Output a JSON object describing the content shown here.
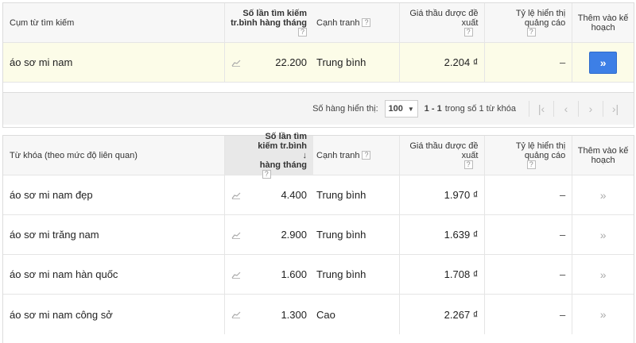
{
  "top_table": {
    "headers": {
      "keyword": "Cụm từ tìm kiếm",
      "volume_line1": "Số lần tìm kiếm",
      "volume_line2": "tr.bình hàng tháng",
      "competition": "Cạnh tranh",
      "bid_line1": "Giá thầu được đề",
      "bid_line2": "xuất",
      "impression_line1": "Tỷ lệ hiển thị",
      "impression_line2": "quảng cáo",
      "add_line1": "Thêm vào kế",
      "add_line2": "hoạch",
      "help": "?"
    },
    "rows": [
      {
        "keyword": "áo sơ mi nam",
        "volume": "22.200",
        "competition": "Trung bình",
        "bid": "2.204 ₫",
        "impression": "–",
        "add": "»"
      }
    ]
  },
  "pager": {
    "rows_label": "Số hàng hiển thị:",
    "rows_value": "100",
    "range_text": "1 - 1",
    "range_suffix": "trong số 1 từ khóa",
    "first": "|‹",
    "prev": "‹",
    "next": "›",
    "last": "›|"
  },
  "bottom_table": {
    "headers": {
      "keyword": "Từ khóa (theo mức độ liên quan)",
      "volume_line1": "Số lần tìm",
      "volume_line2": "kiếm tr.bình",
      "volume_line3": "hàng tháng",
      "sort_arrow": "↓",
      "competition": "Cạnh tranh",
      "bid_line1": "Giá thầu được đề",
      "bid_line2": "xuất",
      "impression_line1": "Tỷ lệ hiển thị",
      "impression_line2": "quảng cáo",
      "add_line1": "Thêm vào kế",
      "add_line2": "hoạch",
      "help": "?"
    },
    "rows": [
      {
        "keyword": "áo sơ mi nam đẹp",
        "volume": "4.400",
        "competition": "Trung bình",
        "bid": "1.970 ₫",
        "impression": "–",
        "add": "»"
      },
      {
        "keyword": "áo sơ mi trăng nam",
        "volume": "2.900",
        "competition": "Trung bình",
        "bid": "1.639 ₫",
        "impression": "–",
        "add": "»"
      },
      {
        "keyword": "áo sơ mi nam hàn quốc",
        "volume": "1.600",
        "competition": "Trung bình",
        "bid": "1.708 ₫",
        "impression": "–",
        "add": "»"
      },
      {
        "keyword": "áo sơ mi nam công sở",
        "volume": "1.300",
        "competition": "Cao",
        "bid": "2.267 ₫",
        "impression": "–",
        "add": "»"
      }
    ]
  },
  "colors": {
    "accent": "#3d7fe6",
    "highlight_row": "#fcfce8"
  }
}
